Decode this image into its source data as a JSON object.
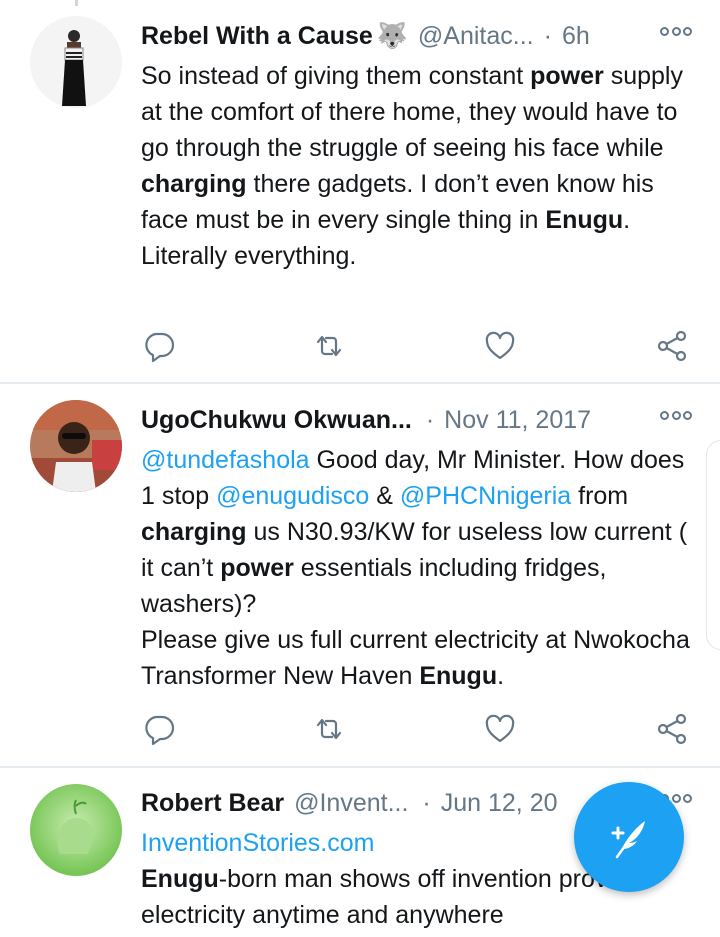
{
  "tweets": [
    {
      "name": "Rebel With a Cause",
      "emoji": "🐺",
      "handle": "@Anitac...",
      "separator": "·",
      "time": "6h",
      "body_segments": [
        {
          "text": "So instead of giving them constant ",
          "style": "plain"
        },
        {
          "text": "power",
          "style": "bold"
        },
        {
          "text": " supply at the comfort of there home, they would have to go through the struggle of seeing his face while ",
          "style": "plain"
        },
        {
          "text": "charging",
          "style": "bold"
        },
        {
          "text": " there gadgets. I don’t even know his face must be in every single thing in ",
          "style": "plain"
        },
        {
          "text": "Enugu",
          "style": "bold"
        },
        {
          "text": ". Literally everything.",
          "style": "plain"
        }
      ]
    },
    {
      "name": "UgoChukwu Okwuan...",
      "handle": "",
      "separator": "·",
      "time": "Nov 11, 2017",
      "body_segments": [
        {
          "text": "@tundefashola",
          "style": "link"
        },
        {
          "text": " Good day, Mr Minister. How does 1 stop ",
          "style": "plain"
        },
        {
          "text": "@enugudisco",
          "style": "link"
        },
        {
          "text": " & ",
          "style": "plain"
        },
        {
          "text": "@PHCNnigeria",
          "style": "link"
        },
        {
          "text": " from ",
          "style": "plain"
        },
        {
          "text": "charging",
          "style": "bold"
        },
        {
          "text": " us N30.93/KW for useless low current ( it can’t ",
          "style": "plain"
        },
        {
          "text": "power",
          "style": "bold"
        },
        {
          "text": " essentials including fridges, washers)?\nPlease give us full current electricity at Nwokocha Transformer New Haven ",
          "style": "plain"
        },
        {
          "text": "Enugu",
          "style": "bold"
        },
        {
          "text": ".",
          "style": "plain"
        }
      ]
    },
    {
      "name": "Robert Bear",
      "handle": "@Invent...",
      "separator": "·",
      "time": "Jun 12, 20",
      "body_segments": [
        {
          "text": "InventionStories.com",
          "style": "link"
        },
        {
          "text": "\n",
          "style": "plain"
        },
        {
          "text": "Enugu",
          "style": "bold"
        },
        {
          "text": "-born man shows off invention provides electricity anytime and anywhere",
          "style": "plain"
        }
      ]
    }
  ],
  "icons": {
    "reply": "reply-icon",
    "retweet": "retweet-icon",
    "like": "like-icon",
    "share": "share-icon",
    "more": "more-icon",
    "compose": "compose-tweet-icon"
  },
  "colors": {
    "link": "#1da1f2",
    "fab": "#1da1f2",
    "secondary_text": "#657786",
    "divider": "#e6ecf0"
  }
}
